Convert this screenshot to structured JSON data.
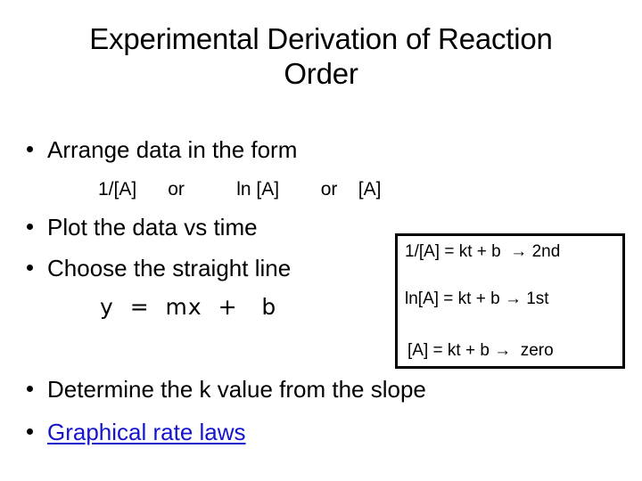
{
  "slide": {
    "title": "Experimental Derivation of Reaction\nOrder",
    "bullets": [
      {
        "id": "b1",
        "text": "Arrange data in the form",
        "link": false
      },
      {
        "id": "b2",
        "text": "Plot the data vs time",
        "link": false
      },
      {
        "id": "b3",
        "text": "Choose the straight line",
        "link": false
      },
      {
        "id": "b4",
        "text": "Determine the k value from the slope",
        "link": false
      },
      {
        "id": "b5",
        "text": "Graphical rate laws",
        "link": true
      }
    ],
    "subline": "1/[A]      or          ln [A]        or    [A]",
    "linear_equation": "y  =  mx  +   b",
    "equation_box": {
      "lines": [
        "1/[A] = kt + b  → 2nd",
        "ln[A] = kt + b → 1st",
        "[A] = kt + b →  zero"
      ]
    },
    "colors": {
      "background": "#ffffff",
      "text": "#000000",
      "hyperlink": "#1414cc",
      "box_border": "#000000"
    }
  }
}
